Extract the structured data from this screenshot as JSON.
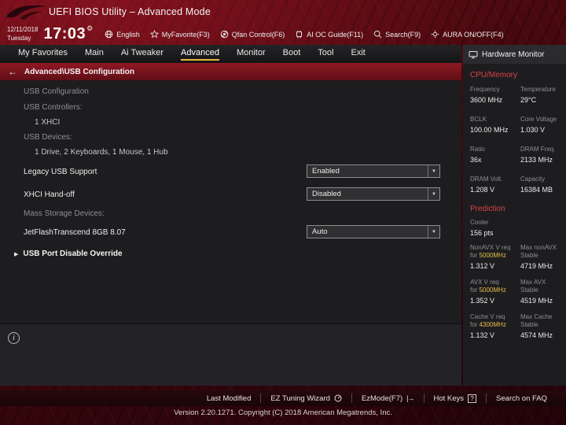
{
  "icons": {
    "back_arrow": "←",
    "caret_down": "▼",
    "submenu_arrow": "▶",
    "gear": "⚙",
    "question": "?",
    "ezmode_glyph": "|→"
  },
  "titlebar": {
    "title": "UEFI BIOS Utility – Advanced Mode"
  },
  "topbar": {
    "date": "12/11/2018",
    "day": "Tuesday",
    "time": "17:03",
    "buttons": [
      {
        "label": "English",
        "icon": "globe-icon"
      },
      {
        "label": "MyFavorite(F3)",
        "icon": "favorite-icon"
      },
      {
        "label": "Qfan Control(F6)",
        "icon": "fan-icon"
      },
      {
        "label": "AI OC Guide(F11)",
        "icon": "ai-oc-icon"
      },
      {
        "label": "Search(F9)",
        "icon": "search-icon"
      },
      {
        "label": "AURA ON/OFF(F4)",
        "icon": "aura-icon"
      }
    ]
  },
  "menu": {
    "tabs": [
      {
        "label": "My Favorites"
      },
      {
        "label": "Main"
      },
      {
        "label": "Ai Tweaker"
      },
      {
        "label": "Advanced"
      },
      {
        "label": "Monitor"
      },
      {
        "label": "Boot"
      },
      {
        "label": "Tool"
      },
      {
        "label": "Exit"
      }
    ],
    "active_tab": "Advanced"
  },
  "breadcrumb": {
    "path": "Advanced\\USB Configuration"
  },
  "main": {
    "section_title": "USB Configuration",
    "controllers_label": "USB Controllers:",
    "controllers_value": "1 XHCI",
    "devices_label": "USB Devices:",
    "devices_value": "1 Drive, 2 Keyboards, 1 Mouse, 1 Hub",
    "settings": [
      {
        "label": "Legacy USB Support",
        "value": "Enabled"
      },
      {
        "label": "XHCI Hand-off",
        "value": "Disabled"
      }
    ],
    "mass_storage_label": "Mass Storage Devices:",
    "mass_storage_setting": {
      "label": "JetFlashTranscend 8GB 8.07",
      "value": "Auto"
    },
    "submenu_label": "USB Port Disable Override"
  },
  "hardware_monitor": {
    "title": "Hardware Monitor",
    "cpu_memory": {
      "title": "CPU/Memory",
      "rows": [
        {
          "l_label": "Frequency",
          "l_value": "3600 MHz",
          "r_label": "Temperature",
          "r_value": "29°C"
        },
        {
          "l_label": "BCLK",
          "l_value": "100.00 MHz",
          "r_label": "Core Voltage",
          "r_value": "1.030 V"
        },
        {
          "l_label": "Ratio",
          "l_value": "36x",
          "r_label": "DRAM Freq.",
          "r_value": "2133 MHz"
        },
        {
          "l_label": "DRAM Volt.",
          "l_value": "1.208 V",
          "r_label": "Capacity",
          "r_value": "16384 MB"
        }
      ]
    },
    "prediction": {
      "title": "Prediction",
      "cooler_label": "Cooler",
      "cooler_value": "156 pts",
      "rows": [
        {
          "l1": "NonAVX V req",
          "l2": "for",
          "freq": "5000MHz",
          "l_value": "1.312 V",
          "r1": "Max nonAVX",
          "r2": "Stable",
          "r_value": "4719 MHz"
        },
        {
          "l1": "AVX V req",
          "l2": "for",
          "freq": "5000MHz",
          "l_value": "1.352 V",
          "r1": "Max AVX",
          "r2": "Stable",
          "r_value": "4519 MHz"
        },
        {
          "l1": "Cache V req",
          "l2": "for",
          "freq": "4300MHz",
          "l_value": "1.132 V",
          "r1": "Max Cache",
          "r2": "Stable",
          "r_value": "4574 MHz"
        }
      ]
    }
  },
  "bottombar": {
    "items": [
      {
        "label": "Last Modified"
      },
      {
        "label": "EZ Tuning Wizard"
      },
      {
        "label": "EzMode(F7)"
      },
      {
        "label": "Hot Keys"
      },
      {
        "label": "Search on FAQ"
      }
    ]
  },
  "footer": {
    "version": "Version 2.20.1271. Copyright (C) 2018 American Megatrends, Inc."
  },
  "colors": {
    "accent_yellow": "#e8bf4a",
    "rog_red": "#8c1622",
    "section_red": "#d84343"
  }
}
